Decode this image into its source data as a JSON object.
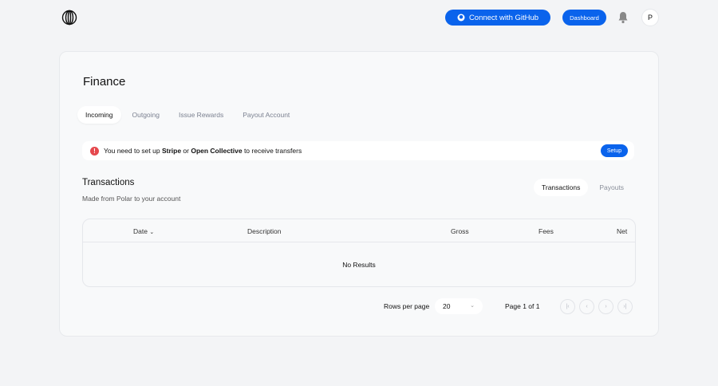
{
  "header": {
    "github_label": "Connect with GitHub",
    "dashboard_label": "Dashboard",
    "avatar_initial": "P"
  },
  "page": {
    "title": "Finance",
    "tabs": [
      {
        "label": "Incoming"
      },
      {
        "label": "Outgoing"
      },
      {
        "label": "Issue Rewards"
      },
      {
        "label": "Payout Account"
      }
    ],
    "alert": {
      "prefix": "You need to set up ",
      "stripe": "Stripe",
      "or": " or ",
      "oc": "Open Collective",
      "suffix": " to receive transfers",
      "button": "Setup"
    },
    "section": {
      "title": "Transactions",
      "subtitle": "Made from Polar to your account",
      "toggle": [
        "Transactions",
        "Payouts"
      ]
    },
    "table": {
      "columns": [
        "Date",
        "Description",
        "Gross",
        "Fees",
        "Net"
      ],
      "empty": "No Results"
    },
    "pagination": {
      "rows_label": "Rows per page",
      "rows_value": "20",
      "page_info": "Page 1 of 1"
    }
  }
}
